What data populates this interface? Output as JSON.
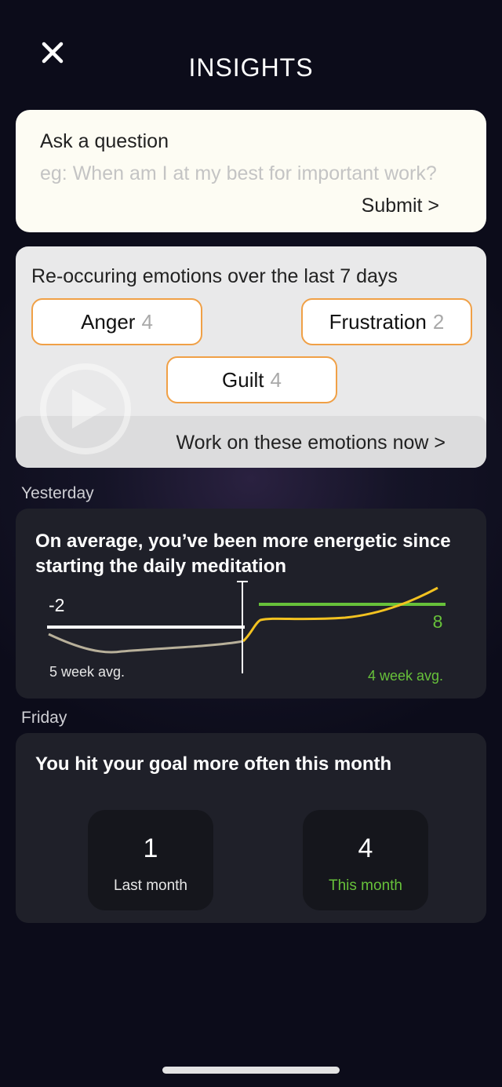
{
  "header": {
    "title": "INSIGHTS"
  },
  "ask": {
    "label": "Ask a  question",
    "placeholder": "eg: When am I at my best for important work?",
    "value": "",
    "submit_label": "Submit >"
  },
  "emotions": {
    "title": "Re-occuring emotions over the last 7 days",
    "chips": [
      {
        "name": "Anger",
        "count": "4"
      },
      {
        "name": "Frustration",
        "count": "2"
      },
      {
        "name": "Guilt",
        "count": "4"
      }
    ],
    "action_label": "Work on these emotions now >"
  },
  "sections": {
    "yesterday": "Yesterday",
    "friday": "Friday"
  },
  "energy": {
    "title": "On average, you’ve been more energetic since starting the daily meditation",
    "left_value": "-2",
    "right_value": "8",
    "left_label": "5 week avg.",
    "right_label": "4 week avg."
  },
  "goal": {
    "title": "You hit your goal more often this month",
    "last_month": {
      "value": "1",
      "label": "Last month"
    },
    "this_month": {
      "value": "4",
      "label": "This month"
    }
  },
  "colors": {
    "accent_orange": "#f0a046",
    "green": "#67c13a",
    "yellow_line": "#f3c220",
    "grey_line": "#b8b09a"
  }
}
